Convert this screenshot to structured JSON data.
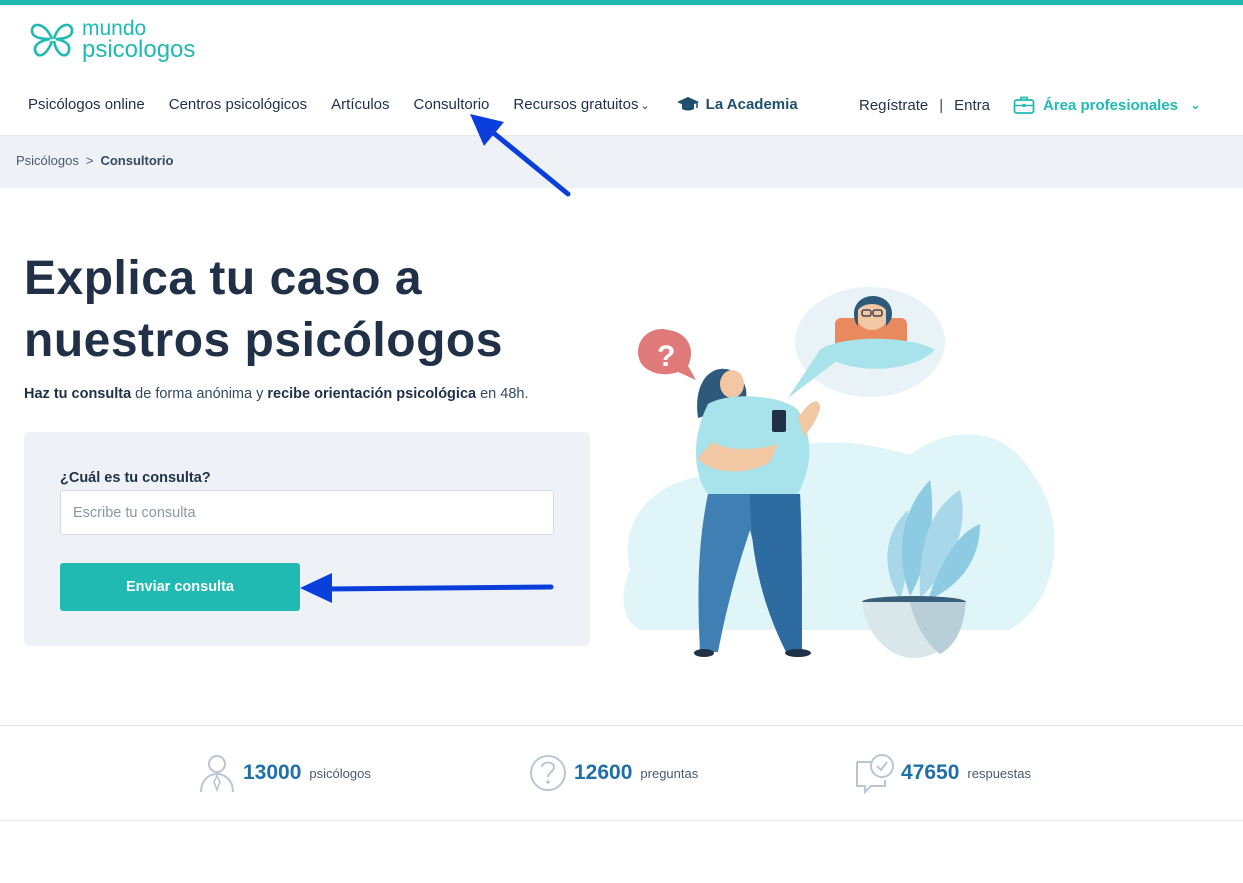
{
  "brand": {
    "line1": "mundo",
    "line2": "psicologos",
    "accent_color": "#20bab3"
  },
  "nav": {
    "items": [
      {
        "label": "Psicólogos online"
      },
      {
        "label": "Centros psicológicos"
      },
      {
        "label": "Artículos"
      },
      {
        "label": "Consultorio"
      },
      {
        "label": "Recursos gratuitos",
        "icon": "chevron-down-icon"
      }
    ],
    "academia": {
      "label": "La Academia",
      "icon": "graduation-cap-icon"
    },
    "register": "Regístrate",
    "separator": "|",
    "login": "Entra",
    "professionals": {
      "label": "Área profesionales",
      "icon": "briefcase-icon"
    }
  },
  "breadcrumb": {
    "home": "Psicólogos",
    "separator": ">",
    "current": "Consultorio"
  },
  "hero": {
    "title": "Explica tu caso a nuestros psicólogos",
    "subtitle": {
      "part1": "Haz tu consulta",
      "part2": " de forma anónima y ",
      "part3": "recibe orientación psicológica",
      "part4": " en 48h."
    }
  },
  "form": {
    "label": "¿Cuál es tu consulta?",
    "placeholder": "Escribe tu consulta",
    "value": "",
    "submit_label": "Enviar consulta"
  },
  "stats": [
    {
      "number": "13000",
      "label": "psicólogos",
      "icon": "person-icon"
    },
    {
      "number": "12600",
      "label": "preguntas",
      "icon": "question-icon"
    },
    {
      "number": "47650",
      "label": "respuestas",
      "icon": "chat-check-icon"
    }
  ],
  "colors": {
    "primary": "#20bab3",
    "dark_text": "#1f3047",
    "stat_number": "#1f6fa8",
    "annotation_arrow": "#0a3fdc"
  }
}
